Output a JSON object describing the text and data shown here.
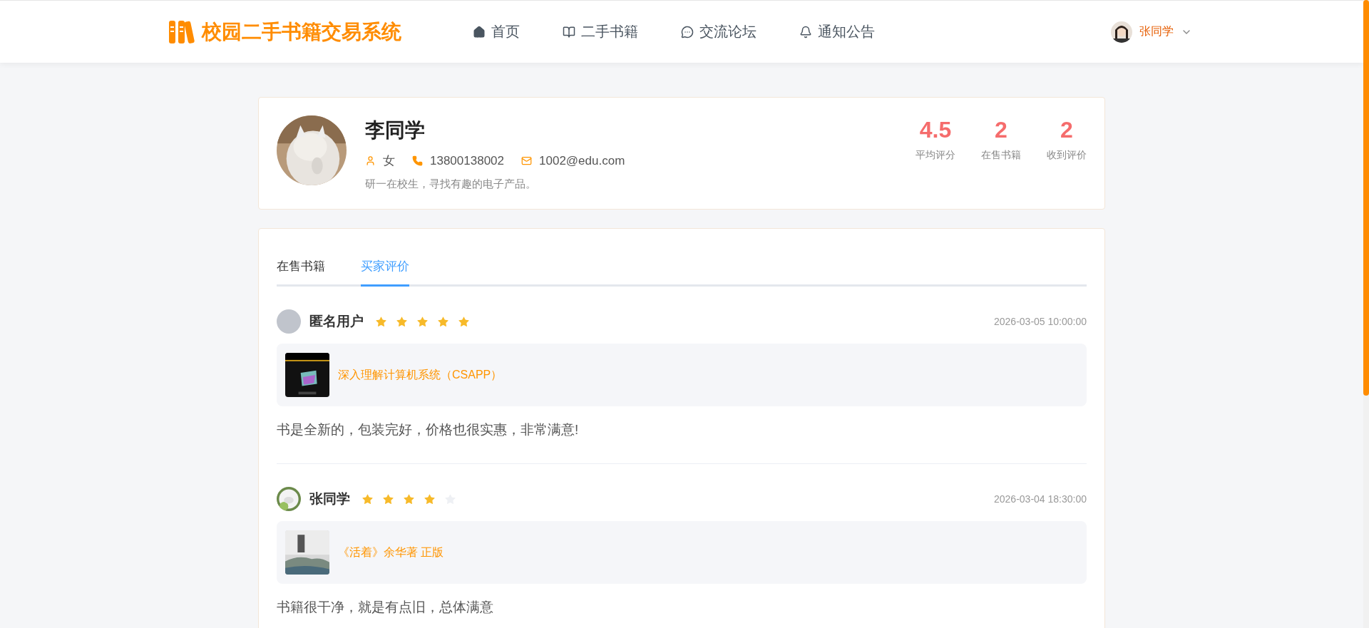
{
  "header": {
    "logo_text": "校园二手书籍交易系统",
    "nav": [
      {
        "label": "首页",
        "selected": false
      },
      {
        "label": "二手书籍",
        "selected": false
      },
      {
        "label": "交流论坛",
        "selected": false
      },
      {
        "label": "通知公告",
        "selected": false
      }
    ],
    "user": {
      "name": "张同学"
    }
  },
  "profile": {
    "name": "李同学",
    "gender": "女",
    "phone": "13800138002",
    "email": "1002@edu.com",
    "bio": "研一在校生，寻找有趣的电子产品。",
    "stats": [
      {
        "value": "4.5",
        "label": "平均评分"
      },
      {
        "value": "2",
        "label": "在售书籍"
      },
      {
        "value": "2",
        "label": "收到评价"
      }
    ]
  },
  "tabs": [
    {
      "label": "在售书籍",
      "selected": false
    },
    {
      "label": "买家评价",
      "selected": true
    }
  ],
  "reviews": [
    {
      "user": "匿名用户",
      "stars": 5,
      "time": "2026-03-05 10:00:00",
      "book": "深入理解计算机系统（CSAPP）",
      "comment": "书是全新的，包装完好，价格也很实惠，非常满意!"
    },
    {
      "user": "张同学",
      "stars": 4,
      "time": "2026-03-04 18:30:00",
      "book": "《活着》余华著 正版",
      "comment": "书籍很干净，就是有点旧，总体满意"
    }
  ]
}
